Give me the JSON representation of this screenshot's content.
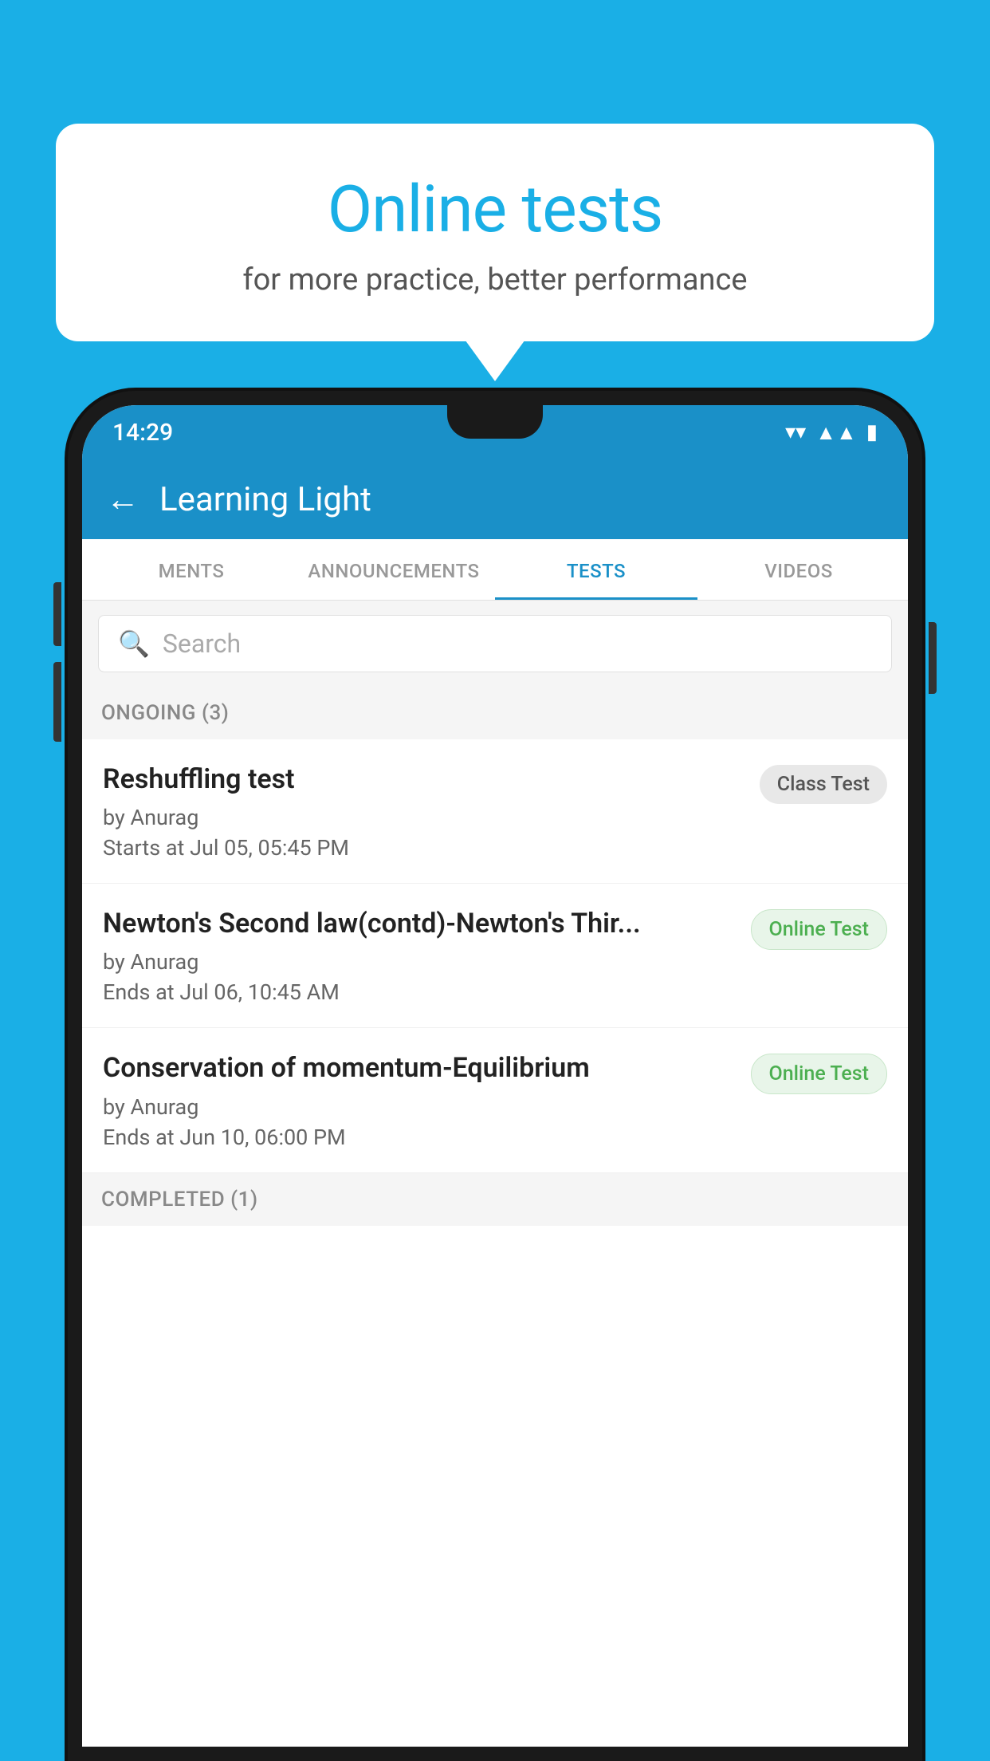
{
  "background_color": "#1AAFE6",
  "bubble": {
    "title": "Online tests",
    "subtitle": "for more practice, better performance"
  },
  "phone": {
    "status_bar": {
      "time": "14:29",
      "wifi": "▾",
      "signal": "▲",
      "battery": "▮"
    },
    "app_bar": {
      "back_label": "←",
      "title": "Learning Light"
    },
    "tabs": [
      {
        "label": "MENTS",
        "active": false
      },
      {
        "label": "ANNOUNCEMENTS",
        "active": false
      },
      {
        "label": "TESTS",
        "active": true
      },
      {
        "label": "VIDEOS",
        "active": false
      }
    ],
    "search": {
      "placeholder": "Search",
      "icon": "🔍"
    },
    "ongoing_section": {
      "label": "ONGOING (3)"
    },
    "test_items": [
      {
        "name": "Reshuffling test",
        "author": "by Anurag",
        "date_label": "Starts at",
        "date": "Jul 05, 05:45 PM",
        "badge_text": "Class Test",
        "badge_type": "class"
      },
      {
        "name": "Newton's Second law(contd)-Newton's Thir...",
        "author": "by Anurag",
        "date_label": "Ends at",
        "date": "Jul 06, 10:45 AM",
        "badge_text": "Online Test",
        "badge_type": "online"
      },
      {
        "name": "Conservation of momentum-Equilibrium",
        "author": "by Anurag",
        "date_label": "Ends at",
        "date": "Jun 10, 06:00 PM",
        "badge_text": "Online Test",
        "badge_type": "online"
      }
    ],
    "completed_section": {
      "label": "COMPLETED (1)"
    }
  }
}
